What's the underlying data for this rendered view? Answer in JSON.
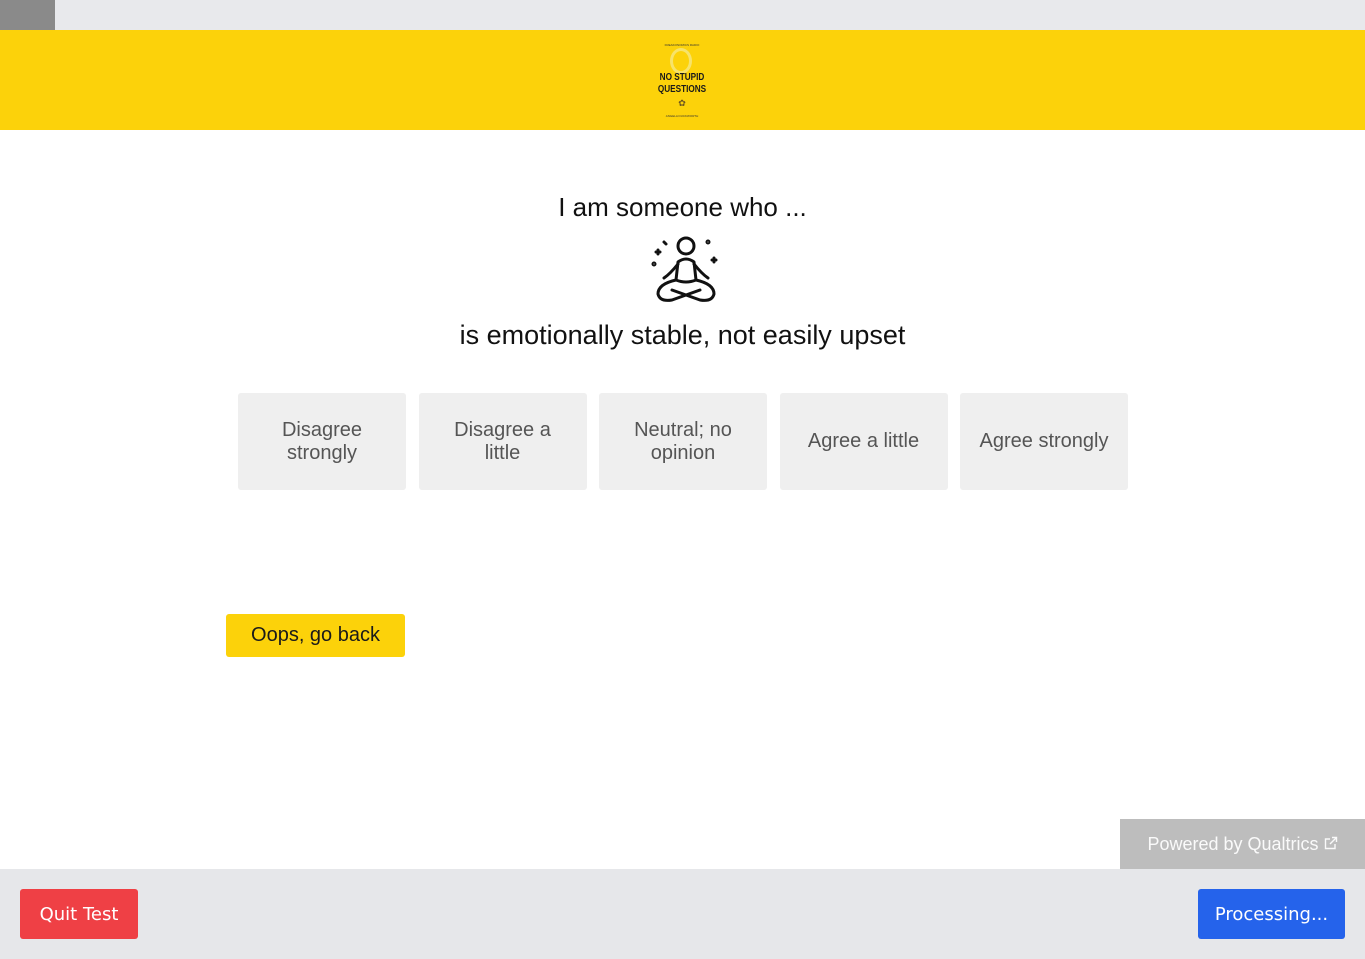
{
  "progress": {
    "value_percent": 4
  },
  "banner": {
    "logo": {
      "top_text": "FREAKONOMICS RADIO",
      "title_line1": "NO STUPID",
      "title_line2": "QUESTIONS",
      "bottom_text": "ANGELA DUCKWORTH",
      "icon": "logo-mark-icon"
    },
    "color": "#fcd20a"
  },
  "question": {
    "intro": "I am someone who ...",
    "icon": "meditation-icon",
    "statement": "is emotionally stable, not easily upset"
  },
  "choices": [
    {
      "label": "Disagree strongly"
    },
    {
      "label": "Disagree a little"
    },
    {
      "label": "Neutral; no opinion"
    },
    {
      "label": "Agree a little"
    },
    {
      "label": "Agree strongly"
    }
  ],
  "navigation": {
    "back_label": "Oops, go back"
  },
  "powered_by": {
    "label": "Powered by Qualtrics",
    "icon": "external-link-icon"
  },
  "footer": {
    "quit_label": "Quit Test",
    "next_label": "Processing...",
    "quit_color": "#ef4045",
    "next_color": "#2563eb"
  }
}
